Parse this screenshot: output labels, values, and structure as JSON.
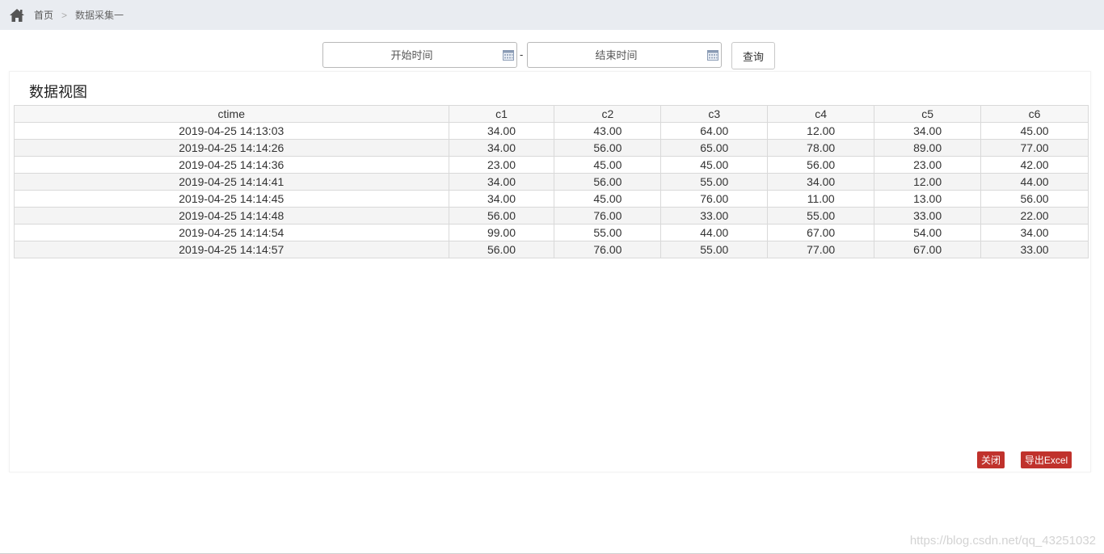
{
  "breadcrumb": {
    "home_label": "首页",
    "separator": ">",
    "current": "数据采集一"
  },
  "filters": {
    "start_placeholder": "开始时间",
    "end_placeholder": "结束时间",
    "dash": "-",
    "query_label": "查询"
  },
  "panel": {
    "title": "数据视图"
  },
  "table": {
    "columns": [
      "ctime",
      "c1",
      "c2",
      "c3",
      "c4",
      "c5",
      "c6"
    ],
    "rows": [
      [
        "2019-04-25 14:13:03",
        "34.00",
        "43.00",
        "64.00",
        "12.00",
        "34.00",
        "45.00"
      ],
      [
        "2019-04-25 14:14:26",
        "34.00",
        "56.00",
        "65.00",
        "78.00",
        "89.00",
        "77.00"
      ],
      [
        "2019-04-25 14:14:36",
        "23.00",
        "45.00",
        "45.00",
        "56.00",
        "23.00",
        "42.00"
      ],
      [
        "2019-04-25 14:14:41",
        "34.00",
        "56.00",
        "55.00",
        "34.00",
        "12.00",
        "44.00"
      ],
      [
        "2019-04-25 14:14:45",
        "34.00",
        "45.00",
        "76.00",
        "11.00",
        "13.00",
        "56.00"
      ],
      [
        "2019-04-25 14:14:48",
        "56.00",
        "76.00",
        "33.00",
        "55.00",
        "33.00",
        "22.00"
      ],
      [
        "2019-04-25 14:14:54",
        "99.00",
        "55.00",
        "44.00",
        "67.00",
        "54.00",
        "34.00"
      ],
      [
        "2019-04-25 14:14:57",
        "56.00",
        "76.00",
        "55.00",
        "77.00",
        "67.00",
        "33.00"
      ]
    ]
  },
  "actions": {
    "close_label": "关闭",
    "export_label": "导出Excel"
  },
  "watermark": "https://blog.csdn.net/qq_43251032",
  "colors": {
    "topbar_bg": "#e9ecf1",
    "button_red": "#c0322c"
  },
  "icons": {
    "home": "home-icon",
    "calendar": "calendar-icon"
  }
}
